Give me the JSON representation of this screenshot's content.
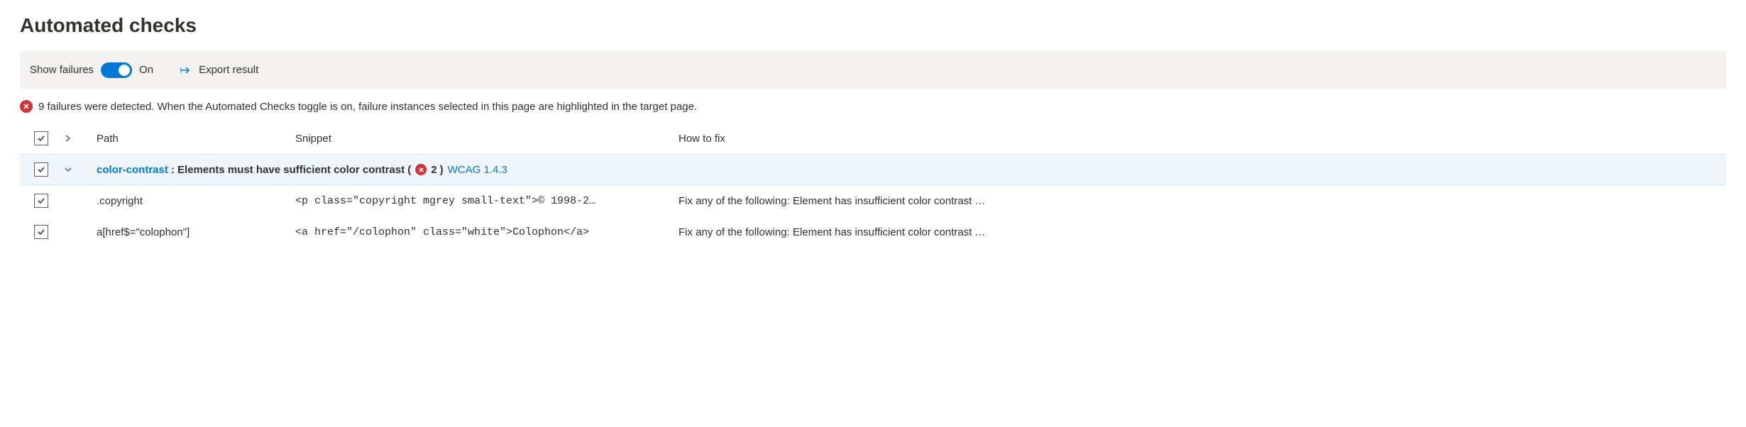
{
  "heading": "Automated checks",
  "toolbar": {
    "toggle_label": "Show failures",
    "toggle_state": "On",
    "export_label": "Export result"
  },
  "status": {
    "text": "9 failures were detected. When the Automated Checks toggle is on, failure instances selected in this page are highlighted in the target page."
  },
  "columns": {
    "path": "Path",
    "snippet": "Snippet",
    "fix": "How to fix"
  },
  "group": {
    "rule_id": "color-contrast",
    "rule_desc": ": Elements must have sufficient color contrast (",
    "count": "2",
    "close_paren": ") ",
    "wcag": "WCAG 1.4.3"
  },
  "rows": [
    {
      "path": ".copyright",
      "snippet": "<p class=\"copyright mgrey small-text\">© 1998-2…",
      "fix": "Fix any of the following: Element has insufficient color contrast …"
    },
    {
      "path": "a[href$=\"colophon\"]",
      "snippet": "<a href=\"/colophon\" class=\"white\">Colophon</a>",
      "fix": "Fix any of the following: Element has insufficient color contrast …"
    }
  ]
}
